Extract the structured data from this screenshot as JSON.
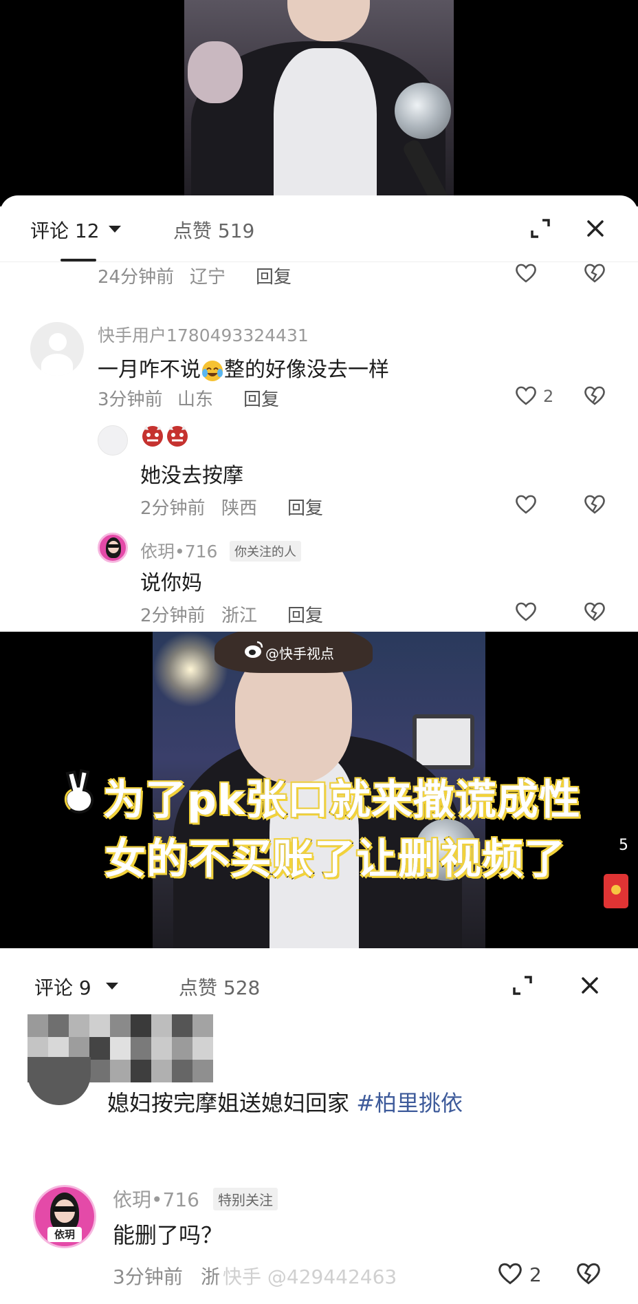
{
  "panel1": {
    "header": {
      "comments_label": "评论 12",
      "likes_label": "点赞 519"
    },
    "partial_row": {
      "time": "24分钟前",
      "region": "辽宁",
      "reply": "回复"
    },
    "comments": [
      {
        "user": "快手用户1780493324431",
        "text_before": "一月咋不说",
        "text_after": "整的好像没去一样",
        "time": "3分钟前",
        "region": "山东",
        "reply": "回复",
        "likes": "2"
      },
      {
        "user": "",
        "emoji_line": "👹👹",
        "text": "她没去按摩",
        "time": "2分钟前",
        "region": "陕西",
        "reply": "回复"
      },
      {
        "user": "依玥•716",
        "badge": "你关注的人",
        "text": "说你妈",
        "time": "2分钟前",
        "region": "浙江",
        "reply": "回复"
      }
    ]
  },
  "video_mid": {
    "weibo_mark": "@快手视点",
    "caption_line1": "为了pk张口就来撒谎成性",
    "caption_line2": "女的不买账了让删视频了",
    "edge_digit": "5"
  },
  "panel2": {
    "header": {
      "comments_label": "评论 9",
      "likes_label": "点赞 528"
    },
    "comments": [
      {
        "text": "媳妇按完摩姐送媳妇回家",
        "hashtag": "#柏里挑依"
      },
      {
        "user": "依玥•716",
        "badge": "特别关注",
        "text": "能删了吗？",
        "time": "3分钟前",
        "region": "浙",
        "likes": "2"
      }
    ],
    "watermark": "快手 @429442463",
    "avatar_label": "依玥"
  },
  "icons": {
    "like": "heart-outline-icon",
    "dislike": "broken-heart-icon",
    "expand": "expand-icon",
    "close": "close-icon"
  },
  "colors": {
    "hashtag": "#3d5a9a",
    "meta": "#8c8c8c",
    "caption_outline": "#f2d23a",
    "avatar_pink": "#e44aa8"
  }
}
